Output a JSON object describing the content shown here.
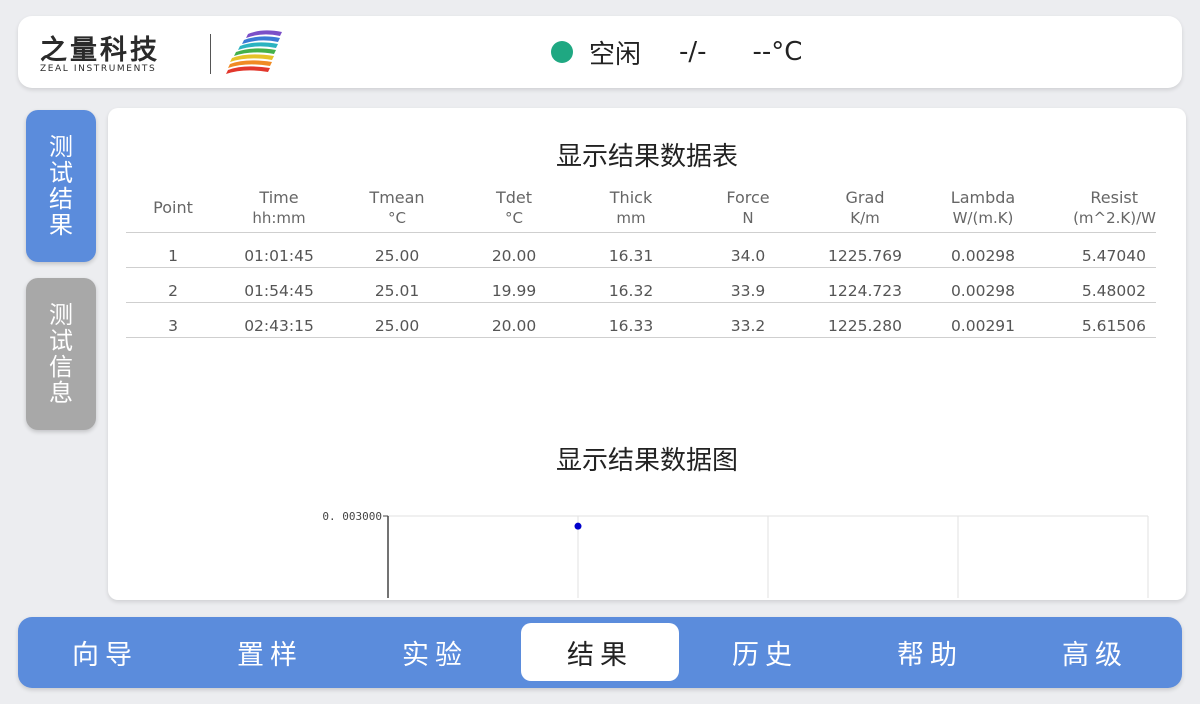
{
  "header": {
    "logo_cn": "之量科技",
    "logo_en": "ZEAL INSTRUMENTS",
    "status_text": "空闲",
    "progress": "-/-",
    "temperature": "--°C",
    "status_color": "#1fa882"
  },
  "side_tabs": [
    {
      "label": "测试结果",
      "active": true
    },
    {
      "label": "测试信息",
      "active": false
    }
  ],
  "table": {
    "title": "显示结果数据表",
    "columns": [
      {
        "name": "Point",
        "unit": ""
      },
      {
        "name": "Time",
        "unit": "hh:mm"
      },
      {
        "name": "Tmean",
        "unit": "°C"
      },
      {
        "name": "Tdet",
        "unit": "°C"
      },
      {
        "name": "Thick",
        "unit": "mm"
      },
      {
        "name": "Force",
        "unit": "N"
      },
      {
        "name": "Grad",
        "unit": "K/m"
      },
      {
        "name": "Lambda",
        "unit": "W/(m.K)"
      },
      {
        "name": "Resist",
        "unit": "(m^2.K)/W"
      }
    ],
    "rows": [
      [
        "1",
        "01:01:45",
        "25.00",
        "20.00",
        "16.31",
        "34.0",
        "1225.769",
        "0.00298",
        "5.47040"
      ],
      [
        "2",
        "01:54:45",
        "25.01",
        "19.99",
        "16.32",
        "33.9",
        "1224.723",
        "0.00298",
        "5.48002"
      ],
      [
        "3",
        "02:43:15",
        "25.00",
        "20.00",
        "16.33",
        "33.2",
        "1225.280",
        "0.00291",
        "5.61506"
      ]
    ]
  },
  "chart": {
    "title": "显示结果数据图"
  },
  "chart_data": {
    "type": "scatter",
    "title": "显示结果数据图",
    "x": [
      1
    ],
    "y": [
      0.00298
    ],
    "y_tick_labels": [
      "0. 003000"
    ],
    "ylim": [
      0.00278,
      0.003
    ],
    "grid": true,
    "point_color": "#0000cc"
  },
  "nav": {
    "items": [
      "向导",
      "置样",
      "实验",
      "结果",
      "历史",
      "帮助",
      "高级"
    ],
    "active_index": 3
  }
}
